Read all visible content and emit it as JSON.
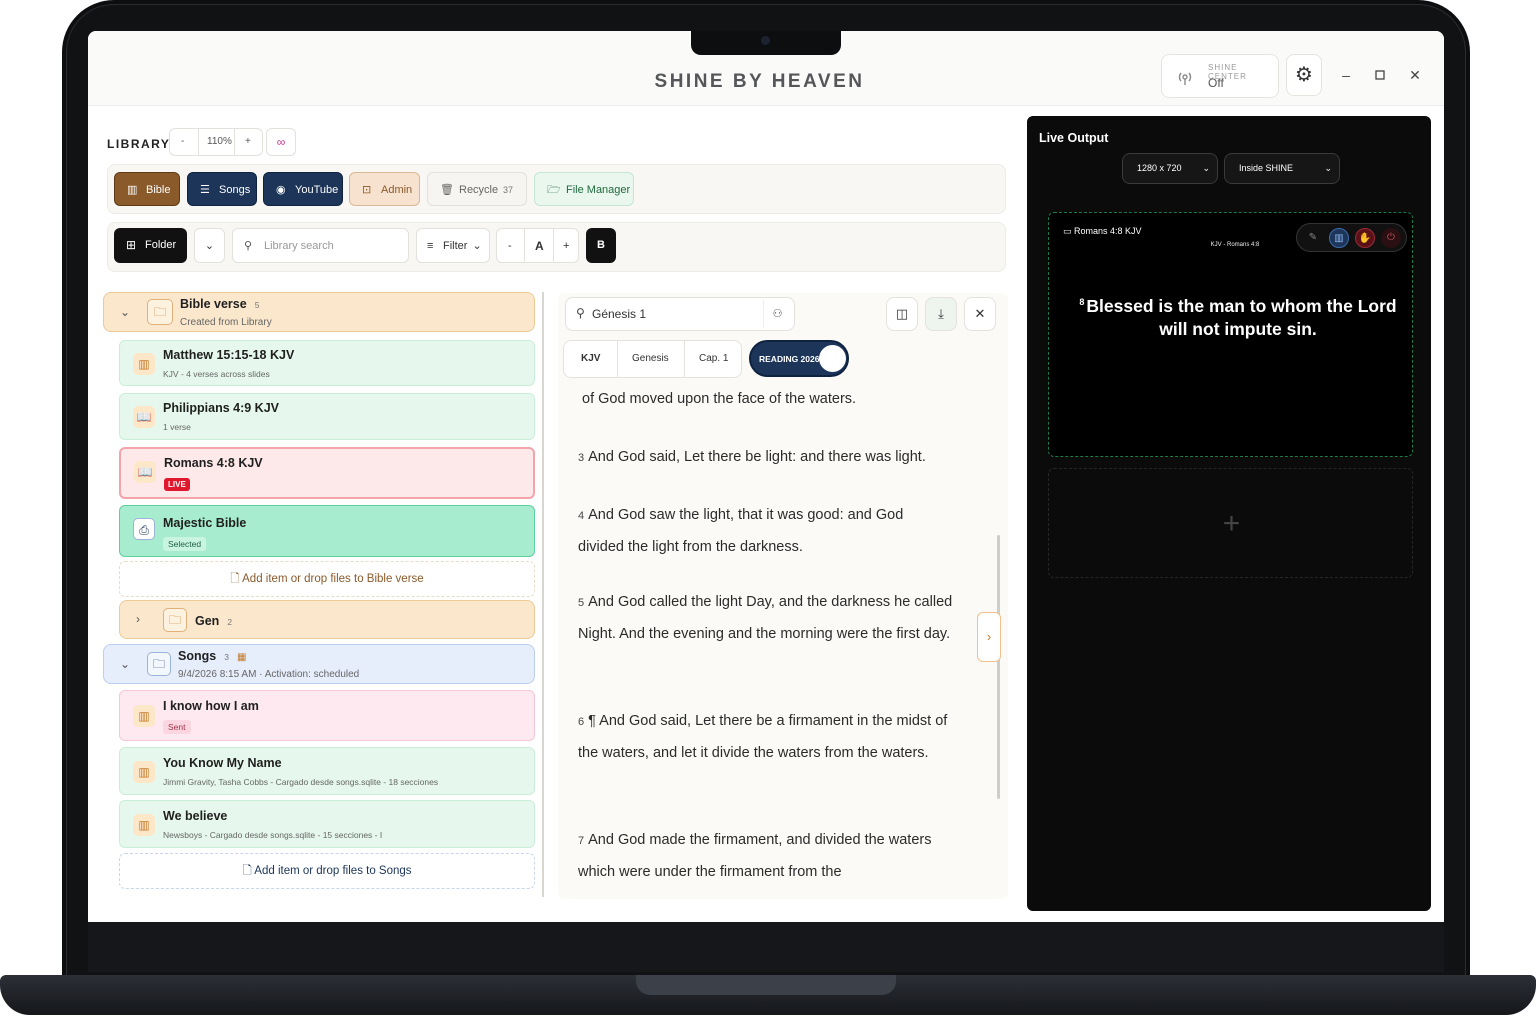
{
  "app": {
    "title": "SHINE BY HEAVEN"
  },
  "shine_center": {
    "label": "SHINE CENTER",
    "status": "Off"
  },
  "library": {
    "label": "LIBRARY",
    "zoom": {
      "minus": "-",
      "value": "110%",
      "plus": "+"
    },
    "tabs": [
      {
        "label": "Bible",
        "icon": "book-icon"
      },
      {
        "label": "Songs",
        "icon": "list-icon"
      },
      {
        "label": "YouTube",
        "icon": "play-icon"
      },
      {
        "label": "Admin",
        "icon": "admin-icon"
      },
      {
        "label": "Recycle",
        "icon": "trash-icon",
        "count": "37"
      },
      {
        "label": "File Manager",
        "icon": "folder-open-icon"
      }
    ],
    "toolbar": {
      "folder": "Folder",
      "search_placeholder": "Library search",
      "filter": "Filter",
      "font_minus": "-",
      "font_a": "A",
      "font_plus": "+",
      "bold": "B"
    },
    "groups": [
      {
        "title": "Bible verse",
        "count": "5",
        "subtitle": "Created from Library",
        "items": [
          {
            "title": "Matthew 15:15-18 KJV",
            "subtitle": "KJV - 4 verses across slides"
          },
          {
            "title": "Philippians 4:9 KJV",
            "subtitle": "1 verse"
          },
          {
            "title": "Romans 4:8 KJV",
            "badge": "LIVE"
          },
          {
            "title": "Majestic Bible",
            "pill": "Selected"
          }
        ],
        "add_label": "Add item or drop files to Bible verse"
      },
      {
        "title": "Gen",
        "count": "2"
      },
      {
        "title": "Songs",
        "count": "3",
        "subtitle": "9/4/2026 8:15 AM · Activation: scheduled",
        "items": [
          {
            "title": "I know how I am",
            "pill": "Sent"
          },
          {
            "title": "You Know My Name",
            "subtitle": "Jimmi Gravity, Tasha Cobbs - Cargado desde songs.sqlite - 18 secciones"
          },
          {
            "title": "We believe",
            "subtitle": "Newsboys - Cargado desde songs.sqlite - 15 secciones - I"
          }
        ],
        "add_label": "Add item or drop files to Songs"
      }
    ]
  },
  "reader": {
    "search_value": "Génesis 1",
    "segments": [
      "KJV",
      "Genesis",
      "Cap. 1"
    ],
    "toggle_label": "READING 2026",
    "verses": [
      {
        "num": "",
        "text": "of God moved upon the face of the waters."
      },
      {
        "num": "3",
        "text": "And God said, Let there be light: and there was light."
      },
      {
        "num": "4",
        "text": "And God saw the light, that it was good: and God divided the light from the darkness."
      },
      {
        "num": "5",
        "text": "And God called the light Day, and the darkness he called Night. And the evening and the morning were the first day."
      },
      {
        "num": "6",
        "text": "¶ And God said, Let there be a firmament in the midst of the waters, and let it divide the waters from the waters."
      },
      {
        "num": "7",
        "text": "And God made the firmament, and divided the waters which were under the firmament from the"
      }
    ]
  },
  "live_output": {
    "title": "Live Output",
    "resolution": "1280 x 720",
    "target": "Inside SHINE",
    "preview": {
      "title": "Romans 4:8 KJV",
      "subtitle": "KJV - Romans 4:8",
      "verse_num": "8",
      "text": "Blessed is the man to whom the Lord will not impute sin."
    },
    "add_symbol": "+"
  },
  "colors": {
    "bible_tab": "#8a5a2b",
    "navy": "#1c3559",
    "live_red": "#e0182e",
    "green_fill": "#a8ecd0",
    "dashed_green": "#1d7a4d"
  }
}
